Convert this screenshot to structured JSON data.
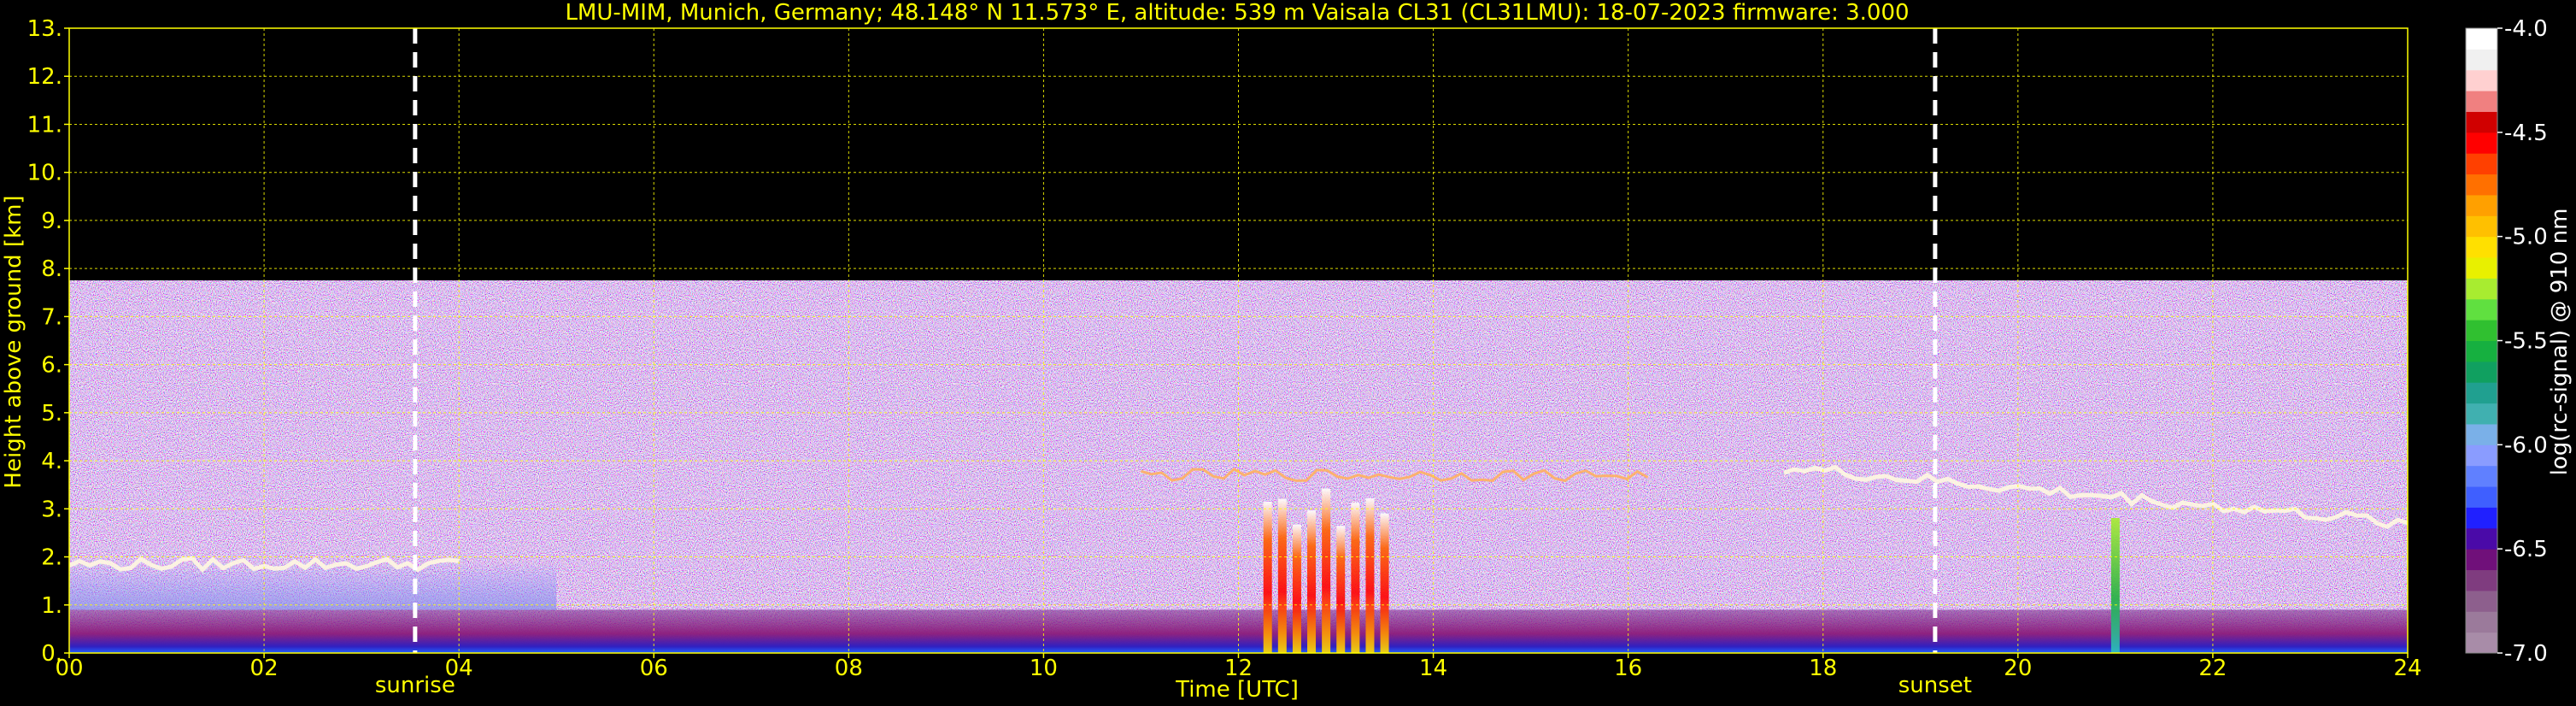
{
  "chart_data": {
    "type": "heatmap",
    "title": "LMU-MIM, Munich, Germany; 48.148° N 11.573° E, altitude: 539 m    Vaisala CL31 (CL31LMU): 18-07-2023    firmware: 3.000",
    "xlabel": "Time [UTC]",
    "ylabel": "Height above ground [km]",
    "xlim": [
      0,
      24
    ],
    "ylim": [
      0,
      13
    ],
    "x_ticks": [
      "00",
      "02",
      "04",
      "06",
      "08",
      "10",
      "12",
      "14",
      "16",
      "18",
      "20",
      "22",
      "24"
    ],
    "y_ticks": [
      "0.",
      "1.",
      "2.",
      "3.",
      "4.",
      "5.",
      "6.",
      "7.",
      "8.",
      "9.",
      "10.",
      "11.",
      "12.",
      "13."
    ],
    "grid": true,
    "markers": [
      {
        "label": "sunrise",
        "time": 3.55
      },
      {
        "label": "sunset",
        "time": 19.15
      }
    ],
    "noise_top_km": 7.75,
    "colorbar": {
      "label": "log(rc-signal) @ 910 nm",
      "range": [
        -7.0,
        -4.0
      ],
      "ticks": [
        "-4.0",
        "-4.5",
        "-5.0",
        "-5.5",
        "-6.0",
        "-6.5",
        "-7.0"
      ],
      "colors": [
        "#a88ca8",
        "#9b7a9b",
        "#8d5f8d",
        "#7f3c7f",
        "#70107a",
        "#4a0aa8",
        "#2020ff",
        "#3f5fff",
        "#6080ff",
        "#8a9cff",
        "#7ab0e8",
        "#40b0b0",
        "#20a090",
        "#10a060",
        "#16b040",
        "#30c030",
        "#60e040",
        "#a8ec30",
        "#e8f000",
        "#ffe000",
        "#ffc000",
        "#ffa000",
        "#ff7000",
        "#ff4000",
        "#ff0000",
        "#d00000",
        "#f08080",
        "#ffd0d0",
        "#f0f0f0",
        "#ffffff"
      ]
    },
    "features": [
      {
        "name": "aerosol boundary layer",
        "t_start": 0,
        "t_end": 24,
        "top_km": 0.9,
        "log_signal": -6.6
      },
      {
        "name": "residual layer",
        "t_start": 0,
        "t_end": 5.0,
        "top_km": 1.9,
        "log_signal": -6.1
      },
      {
        "name": "morning cloud layer",
        "t_start": 0,
        "t_end": 4.0,
        "base_km": 1.85,
        "log_signal": -4.3
      },
      {
        "name": "convective rain shafts",
        "t_start": 12.3,
        "t_end": 13.5,
        "top_km": 3.5,
        "log_signal": -5.0
      },
      {
        "name": "mid-level clouds",
        "t_start": 11.0,
        "t_end": 16.2,
        "base_km": 3.7,
        "log_signal": -4.5
      },
      {
        "name": "evening cloud layer",
        "t_start": 17.6,
        "t_end": 24,
        "base_km": 2.7,
        "log_signal": -4.2
      },
      {
        "name": "rain streak",
        "t_start": 20.9,
        "t_end": 21.1,
        "top_km": 3.4,
        "log_signal": -5.4
      }
    ]
  }
}
